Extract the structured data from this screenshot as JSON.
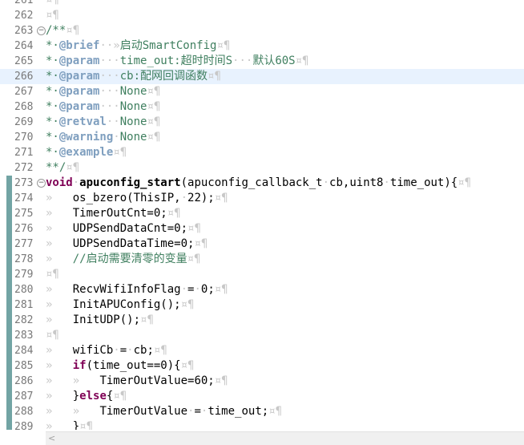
{
  "editor": {
    "lines": [
      {
        "num": "261",
        "fold": "",
        "mod": false,
        "hl": false,
        "tokens": [
          [
            "ws",
            "¤¶"
          ]
        ]
      },
      {
        "num": "262",
        "fold": "",
        "mod": false,
        "hl": false,
        "tokens": [
          [
            "ws",
            "¤¶"
          ]
        ]
      },
      {
        "num": "263",
        "fold": "⊖",
        "mod": false,
        "hl": false,
        "tokens": [
          [
            "comment",
            "/**"
          ],
          [
            "ws",
            "¤¶"
          ]
        ]
      },
      {
        "num": "264",
        "fold": "",
        "mod": false,
        "hl": false,
        "tokens": [
          [
            "comment",
            "*·"
          ],
          [
            "doctag",
            "@brief"
          ],
          [
            "ws",
            "··»"
          ],
          [
            "comment",
            "启动SmartConfig"
          ],
          [
            "ws",
            "¤¶"
          ]
        ]
      },
      {
        "num": "265",
        "fold": "",
        "mod": false,
        "hl": false,
        "tokens": [
          [
            "comment",
            "*·"
          ],
          [
            "doctag",
            "@param"
          ],
          [
            "ws",
            "···"
          ],
          [
            "comment",
            "time_out:超时时间S"
          ],
          [
            "ws",
            "···"
          ],
          [
            "comment",
            "默认60S"
          ],
          [
            "ws",
            "¤¶"
          ]
        ]
      },
      {
        "num": "266",
        "fold": "",
        "mod": false,
        "hl": true,
        "tokens": [
          [
            "comment",
            "*·"
          ],
          [
            "doctag",
            "@param"
          ],
          [
            "ws",
            "···"
          ],
          [
            "comment",
            "cb:配网回调函数"
          ],
          [
            "ws",
            "¤¶"
          ]
        ]
      },
      {
        "num": "267",
        "fold": "",
        "mod": false,
        "hl": false,
        "tokens": [
          [
            "comment",
            "*·"
          ],
          [
            "doctag",
            "@param"
          ],
          [
            "ws",
            "···"
          ],
          [
            "comment",
            "None"
          ],
          [
            "ws",
            "¤¶"
          ]
        ]
      },
      {
        "num": "268",
        "fold": "",
        "mod": false,
        "hl": false,
        "tokens": [
          [
            "comment",
            "*·"
          ],
          [
            "doctag",
            "@param"
          ],
          [
            "ws",
            "···"
          ],
          [
            "comment",
            "None"
          ],
          [
            "ws",
            "¤¶"
          ]
        ]
      },
      {
        "num": "269",
        "fold": "",
        "mod": false,
        "hl": false,
        "tokens": [
          [
            "comment",
            "*·"
          ],
          [
            "doctag",
            "@retval"
          ],
          [
            "ws",
            "··"
          ],
          [
            "comment",
            "None"
          ],
          [
            "ws",
            "¤¶"
          ]
        ]
      },
      {
        "num": "270",
        "fold": "",
        "mod": false,
        "hl": false,
        "tokens": [
          [
            "comment",
            "*·"
          ],
          [
            "doctag",
            "@warning"
          ],
          [
            "ws",
            "·"
          ],
          [
            "comment",
            "None"
          ],
          [
            "ws",
            "¤¶"
          ]
        ]
      },
      {
        "num": "271",
        "fold": "",
        "mod": false,
        "hl": false,
        "tokens": [
          [
            "comment",
            "*·"
          ],
          [
            "doctag",
            "@example"
          ],
          [
            "ws",
            "¤¶"
          ]
        ]
      },
      {
        "num": "272",
        "fold": "",
        "mod": false,
        "hl": false,
        "tokens": [
          [
            "comment",
            "**/"
          ],
          [
            "ws",
            "¤¶"
          ]
        ]
      },
      {
        "num": "273",
        "fold": "⊖",
        "mod": true,
        "hl": false,
        "tokens": [
          [
            "kw",
            "void"
          ],
          [
            "ws",
            "·"
          ],
          [
            "bold",
            "apuconfig_start"
          ],
          [
            "plain",
            "(apuconfig_callback_t"
          ],
          [
            "ws",
            "·"
          ],
          [
            "plain",
            "cb,uint8"
          ],
          [
            "ws",
            "·"
          ],
          [
            "plain",
            "time_out){"
          ],
          [
            "ws",
            "¤¶"
          ]
        ]
      },
      {
        "num": "274",
        "fold": "",
        "mod": true,
        "hl": false,
        "tokens": [
          [
            "ws",
            "»   "
          ],
          [
            "plain",
            "os_bzero(ThisIP,"
          ],
          [
            "ws",
            "·"
          ],
          [
            "plain",
            "22);"
          ],
          [
            "ws",
            "¤¶"
          ]
        ]
      },
      {
        "num": "275",
        "fold": "",
        "mod": true,
        "hl": false,
        "tokens": [
          [
            "ws",
            "»   "
          ],
          [
            "plain",
            "TimerOutCnt=0;"
          ],
          [
            "ws",
            "¤¶"
          ]
        ]
      },
      {
        "num": "276",
        "fold": "",
        "mod": true,
        "hl": false,
        "tokens": [
          [
            "ws",
            "»   "
          ],
          [
            "plain",
            "UDPSendDataCnt=0;"
          ],
          [
            "ws",
            "¤¶"
          ]
        ]
      },
      {
        "num": "277",
        "fold": "",
        "mod": true,
        "hl": false,
        "tokens": [
          [
            "ws",
            "»   "
          ],
          [
            "plain",
            "UDPSendDataTime=0;"
          ],
          [
            "ws",
            "¤¶"
          ]
        ]
      },
      {
        "num": "278",
        "fold": "",
        "mod": true,
        "hl": false,
        "tokens": [
          [
            "ws",
            "»   "
          ],
          [
            "comment",
            "//启动需要清零的变量"
          ],
          [
            "ws",
            "¤¶"
          ]
        ]
      },
      {
        "num": "279",
        "fold": "",
        "mod": true,
        "hl": false,
        "tokens": [
          [
            "ws",
            "¤¶"
          ]
        ]
      },
      {
        "num": "280",
        "fold": "",
        "mod": true,
        "hl": false,
        "tokens": [
          [
            "ws",
            "»   "
          ],
          [
            "plain",
            "RecvWifiInfoFlag"
          ],
          [
            "ws",
            "·"
          ],
          [
            "plain",
            "="
          ],
          [
            "ws",
            "·"
          ],
          [
            "plain",
            "0;"
          ],
          [
            "ws",
            "¤¶"
          ]
        ]
      },
      {
        "num": "281",
        "fold": "",
        "mod": true,
        "hl": false,
        "tokens": [
          [
            "ws",
            "»   "
          ],
          [
            "plain",
            "InitAPUConfig();"
          ],
          [
            "ws",
            "¤¶"
          ]
        ]
      },
      {
        "num": "282",
        "fold": "",
        "mod": true,
        "hl": false,
        "tokens": [
          [
            "ws",
            "»   "
          ],
          [
            "plain",
            "InitUDP();"
          ],
          [
            "ws",
            "¤¶"
          ]
        ]
      },
      {
        "num": "283",
        "fold": "",
        "mod": true,
        "hl": false,
        "tokens": [
          [
            "ws",
            "¤¶"
          ]
        ]
      },
      {
        "num": "284",
        "fold": "",
        "mod": true,
        "hl": false,
        "tokens": [
          [
            "ws",
            "»   "
          ],
          [
            "plain",
            "wifiCb"
          ],
          [
            "ws",
            "·"
          ],
          [
            "plain",
            "="
          ],
          [
            "ws",
            "·"
          ],
          [
            "plain",
            "cb;"
          ],
          [
            "ws",
            "¤¶"
          ]
        ]
      },
      {
        "num": "285",
        "fold": "",
        "mod": true,
        "hl": false,
        "tokens": [
          [
            "ws",
            "»   "
          ],
          [
            "kw",
            "if"
          ],
          [
            "plain",
            "(time_out==0){"
          ],
          [
            "ws",
            "¤¶"
          ]
        ]
      },
      {
        "num": "286",
        "fold": "",
        "mod": true,
        "hl": false,
        "tokens": [
          [
            "ws",
            "»   »   "
          ],
          [
            "plain",
            "TimerOutValue=60;"
          ],
          [
            "ws",
            "¤¶"
          ]
        ]
      },
      {
        "num": "287",
        "fold": "",
        "mod": true,
        "hl": false,
        "tokens": [
          [
            "ws",
            "»   "
          ],
          [
            "plain",
            "}"
          ],
          [
            "kw",
            "else"
          ],
          [
            "plain",
            "{"
          ],
          [
            "ws",
            "¤¶"
          ]
        ]
      },
      {
        "num": "288",
        "fold": "",
        "mod": true,
        "hl": false,
        "tokens": [
          [
            "ws",
            "»   »   "
          ],
          [
            "plain",
            "TimerOutValue"
          ],
          [
            "ws",
            "·"
          ],
          [
            "plain",
            "="
          ],
          [
            "ws",
            "·"
          ],
          [
            "plain",
            "time_out;"
          ],
          [
            "ws",
            "¤¶"
          ]
        ]
      },
      {
        "num": "289",
        "fold": "",
        "mod": true,
        "hl": false,
        "tokens": [
          [
            "ws",
            "»   "
          ],
          [
            "plain",
            "}"
          ],
          [
            "ws",
            "¤¶"
          ]
        ]
      }
    ]
  },
  "scrollbar": {
    "left_arrow": "<"
  }
}
